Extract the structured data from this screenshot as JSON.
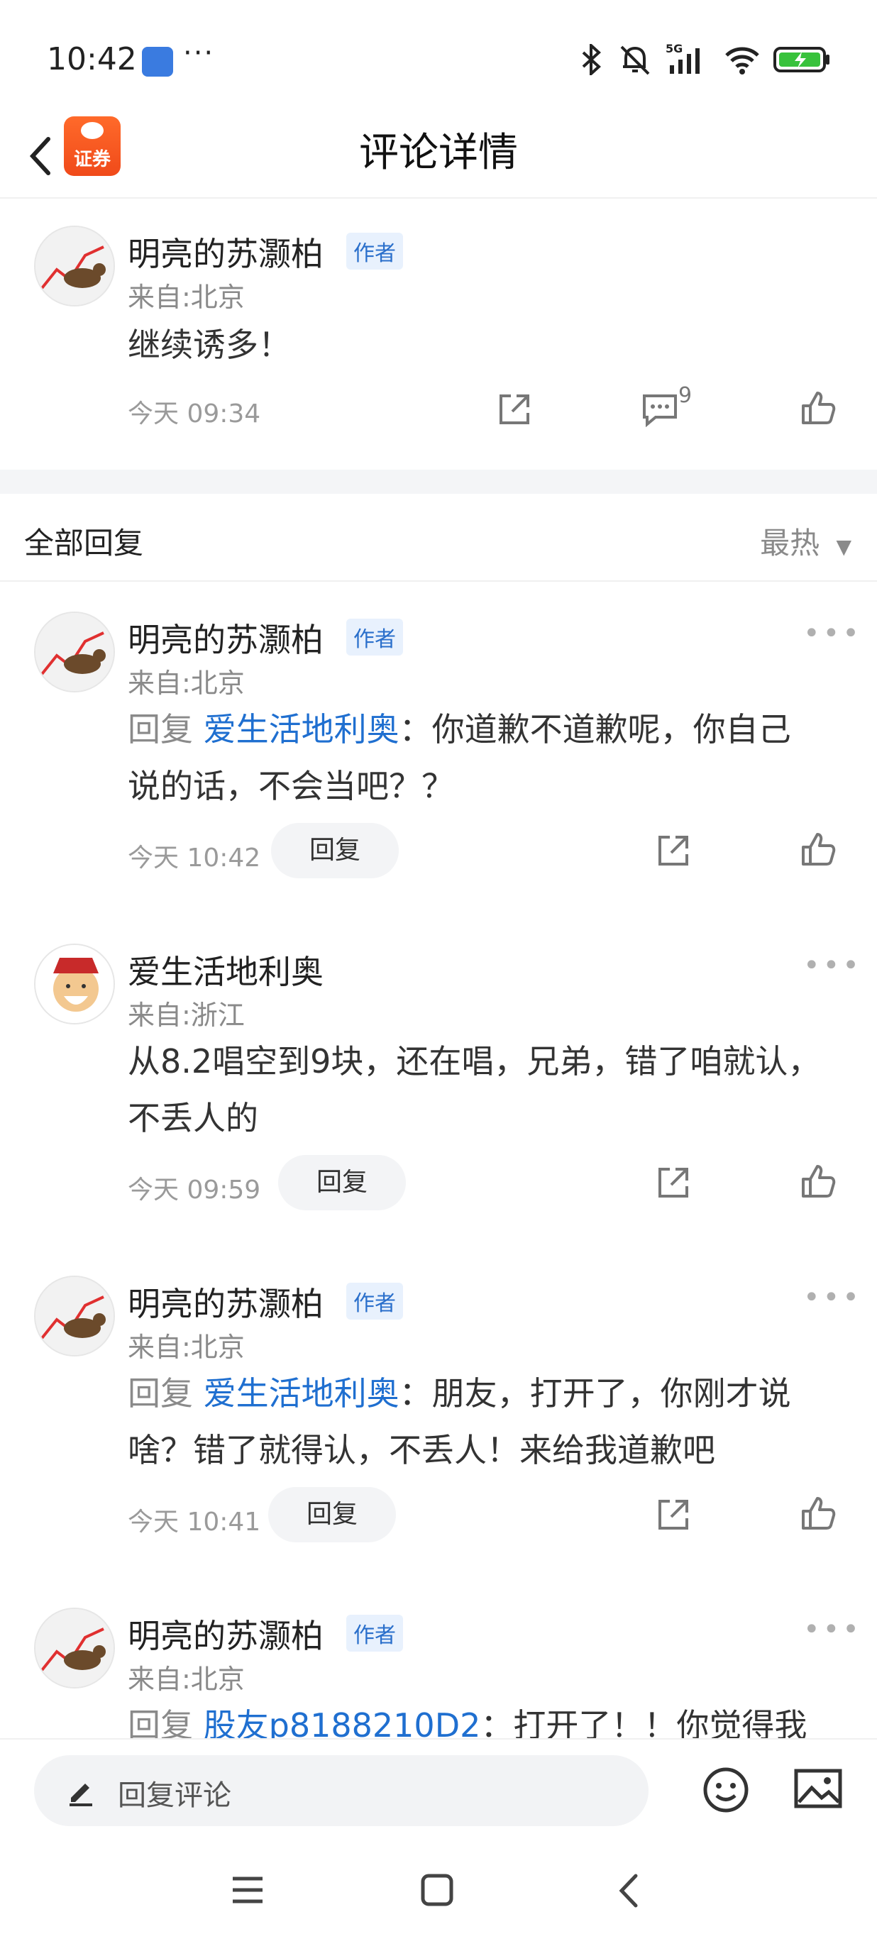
{
  "status_bar": {
    "time": "10:42",
    "more": "···",
    "network": "5G",
    "icons": [
      "bluetooth-icon",
      "mute-icon",
      "signal-icon",
      "wifi-icon",
      "battery-charging-icon"
    ]
  },
  "nav": {
    "title": "评论详情",
    "logo_text": "证券"
  },
  "main_comment": {
    "author": "明亮的苏灏柏",
    "author_tag": "作者",
    "location": "来自:北京",
    "text": "继续诱多！",
    "time": "今天 09:34",
    "reply_count": "9"
  },
  "replies_section": {
    "title": "全部回复",
    "sort": "最热"
  },
  "replies": [
    {
      "author": "明亮的苏灏柏",
      "tag": "作者",
      "location": "来自:北京",
      "reply_label": "回复",
      "reply_to": "爱生活地利奥",
      "line1": "：你道歉不道歉呢，你自己",
      "line2": "说的话，不会当吧？？",
      "time": "今天 10:42",
      "reply_btn": "回复"
    },
    {
      "author": "爱生活地利奥",
      "location": "来自:浙江",
      "line1": "从8.2唱空到9块，还在唱，兄弟，错了咱就认，",
      "line2": "不丢人的",
      "time": "今天 09:59",
      "reply_btn": "回复"
    },
    {
      "author": "明亮的苏灏柏",
      "tag": "作者",
      "location": "来自:北京",
      "reply_label": "回复",
      "reply_to": "爱生活地利奥",
      "line1": "：朋友，打开了，你刚才说",
      "line2": "啥？错了就得认，不丢人！来给我道歉吧",
      "time": "今天 10:41",
      "reply_btn": "回复"
    },
    {
      "author": "明亮的苏灏柏",
      "tag": "作者",
      "location": "来自:北京",
      "reply_label": "回复",
      "reply_to": "股友p8188210D2",
      "line1": "：打开了！！你觉得我的"
    }
  ],
  "bottom": {
    "placeholder": "回复评论"
  }
}
